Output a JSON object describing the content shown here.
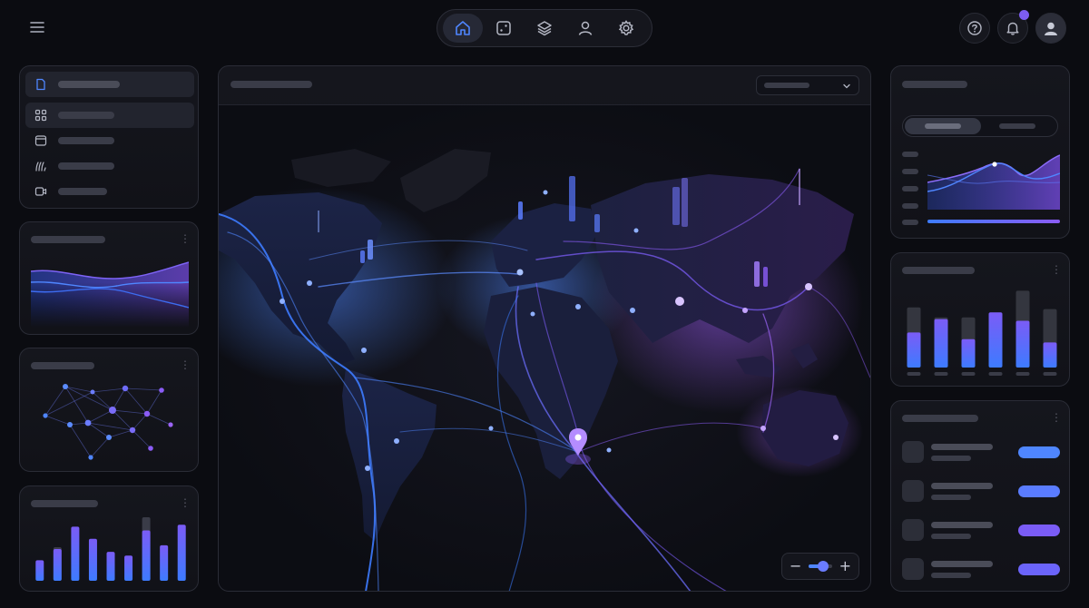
{
  "icons": {
    "menu": "hamburger-menu-icon",
    "home": "home-icon",
    "dice": "dice-icon",
    "layers": "layers-icon",
    "user": "user-icon",
    "settings": "gear-icon",
    "help": "question-icon",
    "notifications": "bell-icon",
    "avatar": "avatar"
  },
  "colors": {
    "background": "#0b0c11",
    "accent_blue": "#3d7bff",
    "accent_purple": "#8b5cf6",
    "notification_badge": "#7c5cf0",
    "skeleton": "#3a3c48"
  },
  "top_nav": {
    "active": "home"
  },
  "left_menu": {
    "items": [
      "document-icon",
      "grid-icon",
      "window-icon",
      "signal-icon",
      "video-icon"
    ],
    "active_index": 1
  },
  "left_bar_chart": {
    "values": [
      22,
      34,
      58,
      45,
      31,
      27,
      54,
      38,
      60
    ],
    "ghost_values": [
      0,
      36,
      0,
      0,
      0,
      0,
      68,
      0,
      0
    ]
  },
  "right_bar_chart": {
    "values": [
      42,
      58,
      34,
      66,
      56,
      30
    ],
    "tracks": [
      72,
      60,
      60,
      66,
      92,
      70
    ]
  },
  "right_list": {
    "pills": [
      "#4f86ff",
      "#5a7cff",
      "#7a5cf6",
      "#6b64fa"
    ]
  },
  "map": {
    "zoom_level": 0.6
  }
}
